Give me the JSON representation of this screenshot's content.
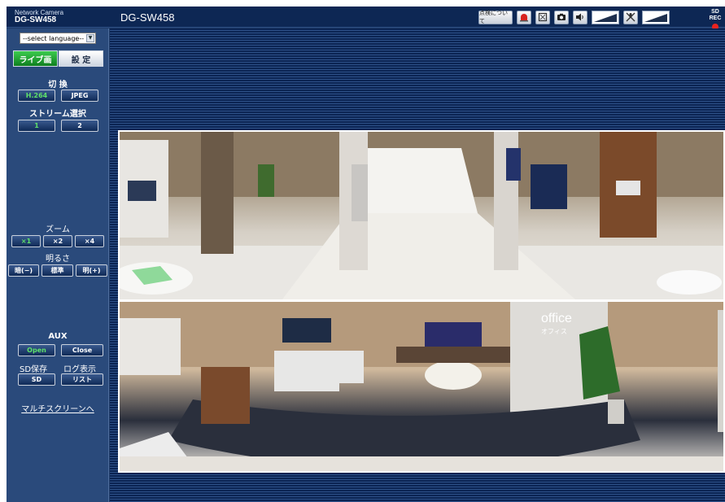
{
  "header": {
    "camera_label": "Network Camera",
    "model": "DG-SW458",
    "title": "DG-SW458",
    "about_label": "点検について",
    "toolbar_icons": [
      "alarm-icon",
      "fullscreen-icon",
      "camera-snapshot-icon",
      "speaker-icon",
      "volume-level-icon",
      "mic-mute-icon",
      "mic-level-icon"
    ],
    "sd_rec_label": "SD REC",
    "sd_rec_color": "#e8231f"
  },
  "sidebar": {
    "language_select": "--select language--",
    "tab_live": "ライブ画",
    "tab_setup": "設 定",
    "switch_label": "切 換",
    "codec_h264": "H.264",
    "codec_jpeg": "JPEG",
    "stream_label": "ストリーム選択",
    "stream_1": "1",
    "stream_2": "2",
    "zoom_label": "ズーム",
    "zoom_x1": "×1",
    "zoom_x2": "×2",
    "zoom_x4": "×4",
    "brightness_label": "明るさ",
    "bright_dark": "暗(−)",
    "bright_normal": "標準",
    "bright_light": "明(+)",
    "aux_label": "AUX",
    "aux_open": "Open",
    "aux_close": "Close",
    "sd_save_label": "SD保存",
    "log_label": "ログ表示",
    "sd_button": "SD",
    "list_button": "リスト",
    "multiscreen_link": "マルチスクリーンへ"
  },
  "video": {
    "overlay_text": "office",
    "overlay_sub": "オフィス"
  },
  "colors": {
    "active_green": "#1a9a2a",
    "panel_blue": "#2a4a7b",
    "header_navy": "#0d2754"
  }
}
